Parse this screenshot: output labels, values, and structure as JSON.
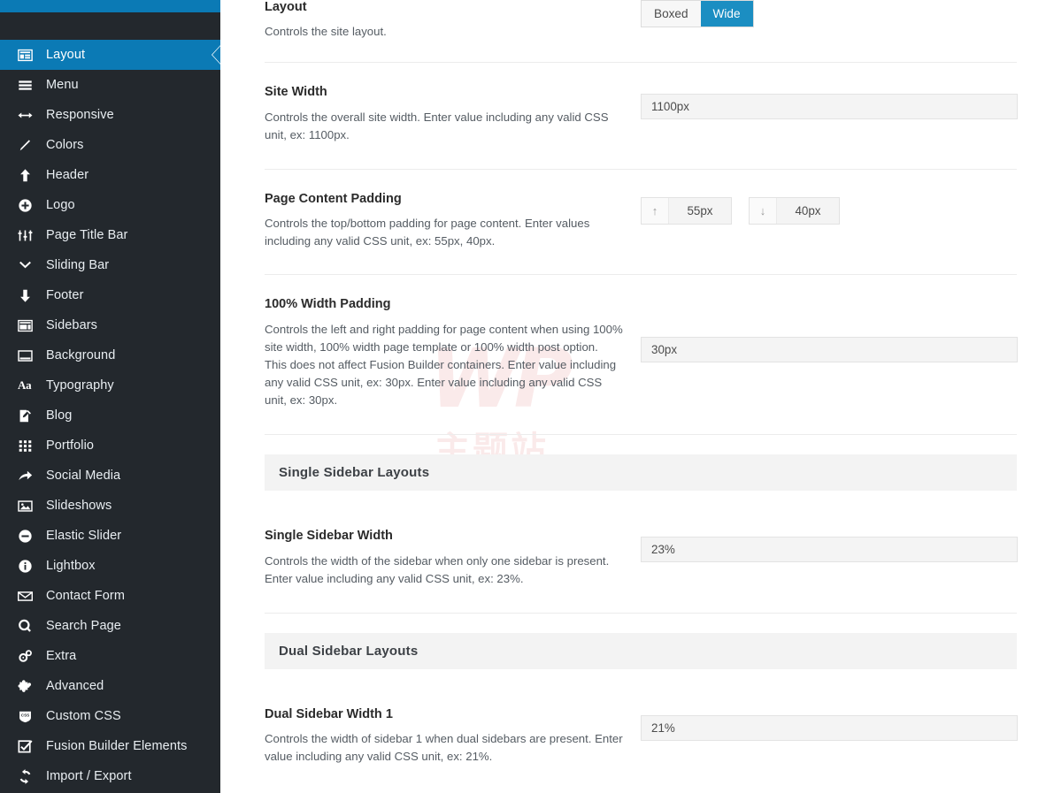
{
  "sidebar": {
    "accent_color": "#0b7ab5",
    "background_color": "#23282d",
    "items": [
      {
        "label": "Layout",
        "icon": "layout-icon",
        "active": true
      },
      {
        "label": "Menu",
        "icon": "menu-bars-icon",
        "active": false
      },
      {
        "label": "Responsive",
        "icon": "arrows-horizontal-icon",
        "active": false
      },
      {
        "label": "Colors",
        "icon": "brush-icon",
        "active": false
      },
      {
        "label": "Header",
        "icon": "arrow-up-icon",
        "active": false
      },
      {
        "label": "Logo",
        "icon": "plus-circle-icon",
        "active": false
      },
      {
        "label": "Page Title Bar",
        "icon": "sliders-icon",
        "active": false
      },
      {
        "label": "Sliding Bar",
        "icon": "chevron-down-icon",
        "active": false
      },
      {
        "label": "Footer",
        "icon": "arrow-down-icon",
        "active": false
      },
      {
        "label": "Sidebars",
        "icon": "sidebars-icon",
        "active": false
      },
      {
        "label": "Background",
        "icon": "background-icon",
        "active": false
      },
      {
        "label": "Typography",
        "icon": "typography-aa-icon",
        "active": false
      },
      {
        "label": "Blog",
        "icon": "pencil-note-icon",
        "active": false
      },
      {
        "label": "Portfolio",
        "icon": "grid-icon",
        "active": false
      },
      {
        "label": "Social Media",
        "icon": "share-arrow-icon",
        "active": false
      },
      {
        "label": "Slideshows",
        "icon": "image-icon",
        "active": false
      },
      {
        "label": "Elastic Slider",
        "icon": "minus-circle-icon",
        "active": false
      },
      {
        "label": "Lightbox",
        "icon": "info-circle-icon",
        "active": false
      },
      {
        "label": "Contact Form",
        "icon": "envelope-icon",
        "active": false
      },
      {
        "label": "Search Page",
        "icon": "magnifier-icon",
        "active": false
      },
      {
        "label": "Extra",
        "icon": "gears-icon",
        "active": false
      },
      {
        "label": "Advanced",
        "icon": "puzzle-piece-icon",
        "active": false
      },
      {
        "label": "Custom CSS",
        "icon": "css-badge-icon",
        "active": false
      },
      {
        "label": "Fusion Builder Elements",
        "icon": "checkbox-icon",
        "active": false
      },
      {
        "label": "Import / Export",
        "icon": "refresh-cycle-icon",
        "active": false
      }
    ]
  },
  "fields": {
    "layout": {
      "title": "Layout",
      "desc": "Controls the site layout.",
      "options": [
        {
          "label": "Boxed",
          "selected": false
        },
        {
          "label": "Wide",
          "selected": true
        }
      ],
      "selected_color": "#1b8ec2"
    },
    "site_width": {
      "title": "Site Width",
      "desc": "Controls the overall site width. Enter value including any valid CSS unit, ex: 1100px.",
      "value": "1100px"
    },
    "page_content_padding": {
      "title": "Page Content Padding",
      "desc": "Controls the top/bottom padding for page content. Enter values including any valid CSS unit, ex: 55px, 40px.",
      "top": {
        "icon": "arrow-up-icon",
        "glyph": "↑",
        "value": "55px"
      },
      "bottom": {
        "icon": "arrow-down-icon",
        "glyph": "↓",
        "value": "40px"
      }
    },
    "full_width_padding": {
      "title": "100% Width Padding",
      "desc": "Controls the left and right padding for page content when using 100% site width, 100% width page template or 100% width post option. This does not affect Fusion Builder containers. Enter value including any valid CSS unit, ex: 30px. Enter value including any valid CSS unit, ex: 30px.",
      "value": "30px"
    },
    "single_sidebar_section": {
      "title": "Single Sidebar Layouts"
    },
    "single_sidebar_width": {
      "title": "Single Sidebar Width",
      "desc": "Controls the width of the sidebar when only one sidebar is present. Enter value including any valid CSS unit, ex: 23%.",
      "value": "23%"
    },
    "dual_sidebar_section": {
      "title": "Dual Sidebar Layouts"
    },
    "dual_sidebar_width_1": {
      "title": "Dual Sidebar Width 1",
      "desc": "Controls the width of sidebar 1 when dual sidebars are present. Enter value including any valid CSS unit, ex: 21%.",
      "value": "21%"
    }
  },
  "watermark": {
    "primary": "WP",
    "secondary": "主题站",
    "color": "#d01b1b"
  }
}
